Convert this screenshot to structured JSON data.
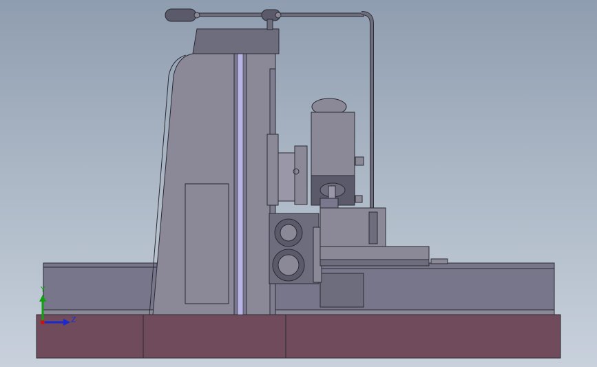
{
  "colors": {
    "background_top": "#8f9db0",
    "background_bottom": "#c8d1dc",
    "base_plate": "#6f4b5b",
    "machine_body": "#8b8998",
    "machine_dark": "#6e6d7d",
    "edge": "#2a2a32",
    "slot_highlight": "#b8b5e6",
    "axis_y": "#10a010",
    "axis_z": "#1a2ad0",
    "axis_x": "#d01010"
  },
  "triad": {
    "y_label": "Y",
    "z_label": "Z"
  }
}
